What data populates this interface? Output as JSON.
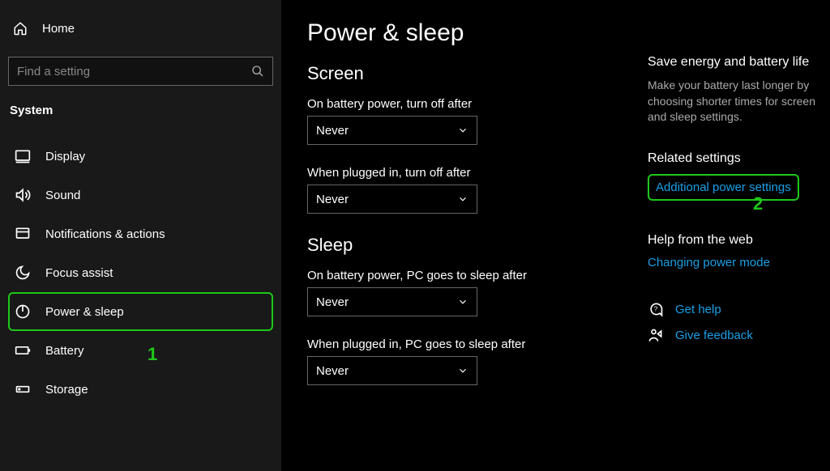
{
  "sidebar": {
    "home_label": "Home",
    "search_placeholder": "Find a setting",
    "section": "System",
    "items": [
      {
        "label": "Display",
        "icon": "display-icon"
      },
      {
        "label": "Sound",
        "icon": "sound-icon"
      },
      {
        "label": "Notifications & actions",
        "icon": "notifications-icon"
      },
      {
        "label": "Focus assist",
        "icon": "moon-icon"
      },
      {
        "label": "Power & sleep",
        "icon": "power-icon"
      },
      {
        "label": "Battery",
        "icon": "battery-icon"
      },
      {
        "label": "Storage",
        "icon": "storage-icon"
      }
    ]
  },
  "page": {
    "title": "Power & sleep",
    "screen": {
      "heading": "Screen",
      "battery_label": "On battery power, turn off after",
      "battery_value": "Never",
      "plugged_label": "When plugged in, turn off after",
      "plugged_value": "Never"
    },
    "sleep": {
      "heading": "Sleep",
      "battery_label": "On battery power, PC goes to sleep after",
      "battery_value": "Never",
      "plugged_label": "When plugged in, PC goes to sleep after",
      "plugged_value": "Never"
    }
  },
  "right": {
    "energy_title": "Save energy and battery life",
    "energy_text": "Make your battery last longer by choosing shorter times for screen and sleep settings.",
    "related_title": "Related settings",
    "related_link": "Additional power settings",
    "webhelp_title": "Help from the web",
    "webhelp_link": "Changing power mode",
    "get_help": "Get help",
    "give_feedback": "Give feedback"
  },
  "annotations": {
    "one": "1",
    "two": "2"
  }
}
